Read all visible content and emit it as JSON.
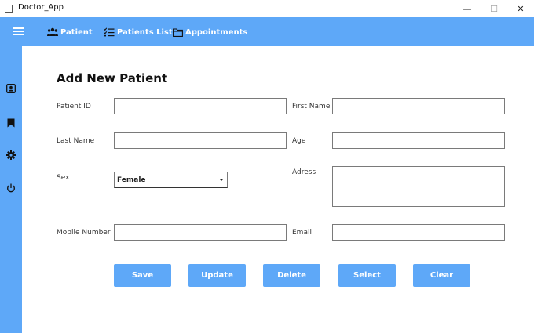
{
  "window": {
    "title": "Doctor_App",
    "minimize_glyph": "—",
    "maximize_glyph": "☐",
    "close_glyph": "✕"
  },
  "nav": {
    "items": [
      {
        "label": "Patient",
        "icon": "people-icon"
      },
      {
        "label": "Patients List",
        "icon": "checklist-icon"
      },
      {
        "label": "Appointments",
        "icon": "folder-icon"
      }
    ]
  },
  "sidebar": {
    "icons": [
      "contact-card-icon",
      "bookmark-icon",
      "gear-icon",
      "power-icon"
    ]
  },
  "form": {
    "title": "Add New Patient",
    "patient_id_label": "Patient ID",
    "patient_id_value": "",
    "first_name_label": "First Name",
    "first_name_value": "",
    "last_name_label": "Last Name",
    "last_name_value": "",
    "age_label": "Age",
    "age_value": "",
    "sex_label": "Sex",
    "sex_selected": "Female",
    "address_label": "Adress",
    "address_value": "",
    "mobile_label": "Mobile Number",
    "mobile_value": "",
    "email_label": "Email",
    "email_value": ""
  },
  "actions": {
    "save": "Save",
    "update": "Update",
    "delete": "Delete",
    "select": "Select",
    "clear": "Clear"
  },
  "colors": {
    "accent": "#5ea8f8"
  }
}
